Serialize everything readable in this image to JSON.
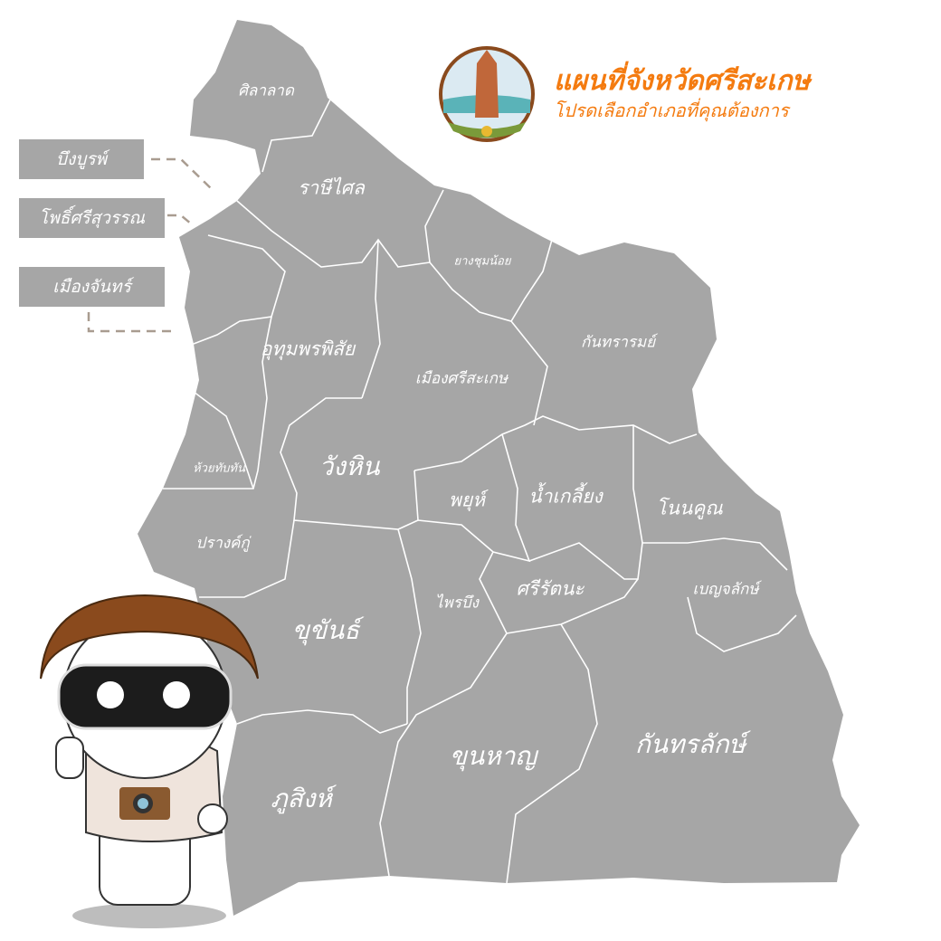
{
  "header": {
    "title": "แผนที่จังหวัดศรีสะเกษ",
    "subtitle": "โปรดเลือกอำเภอที่คุณต้องการ",
    "seal_icon": "sisaket-province-seal"
  },
  "side_labels": [
    "บึงบูรพ์",
    "โพธิ์ศรีสุวรรณ",
    "เมืองจันทร์"
  ],
  "districts": {
    "silalat": "ศิลาลาด",
    "rasisalai": "ราษีไศล",
    "yangchumnoi": "ยางชุมน้อย",
    "kanthararom": "กันทรารมย์",
    "uthumphonphisai": "อุทุมพรพิสัย",
    "mueang": "เมืองศรีสะเกษ",
    "huaithapthan": "ห้วยทับทัน",
    "wanghin": "วังหิน",
    "phayu": "พยุห์",
    "namkliang": "น้ำเกลี้ยง",
    "nonkhun": "โนนคูณ",
    "prangku": "ปรางค์กู่",
    "phraibueng": "ไพรบึง",
    "sirattana": "ศรีรัตนะ",
    "benchalak": "เบญจลักษ์",
    "khukhan": "ขุขันธ์",
    "phusing": "ภูสิงห์",
    "khunhan": "ขุนหาญ",
    "kantharalak": "กันทรลักษ์"
  },
  "colors": {
    "map": "#a6a6a6",
    "border": "#ffffff",
    "accent": "#f47b10"
  }
}
